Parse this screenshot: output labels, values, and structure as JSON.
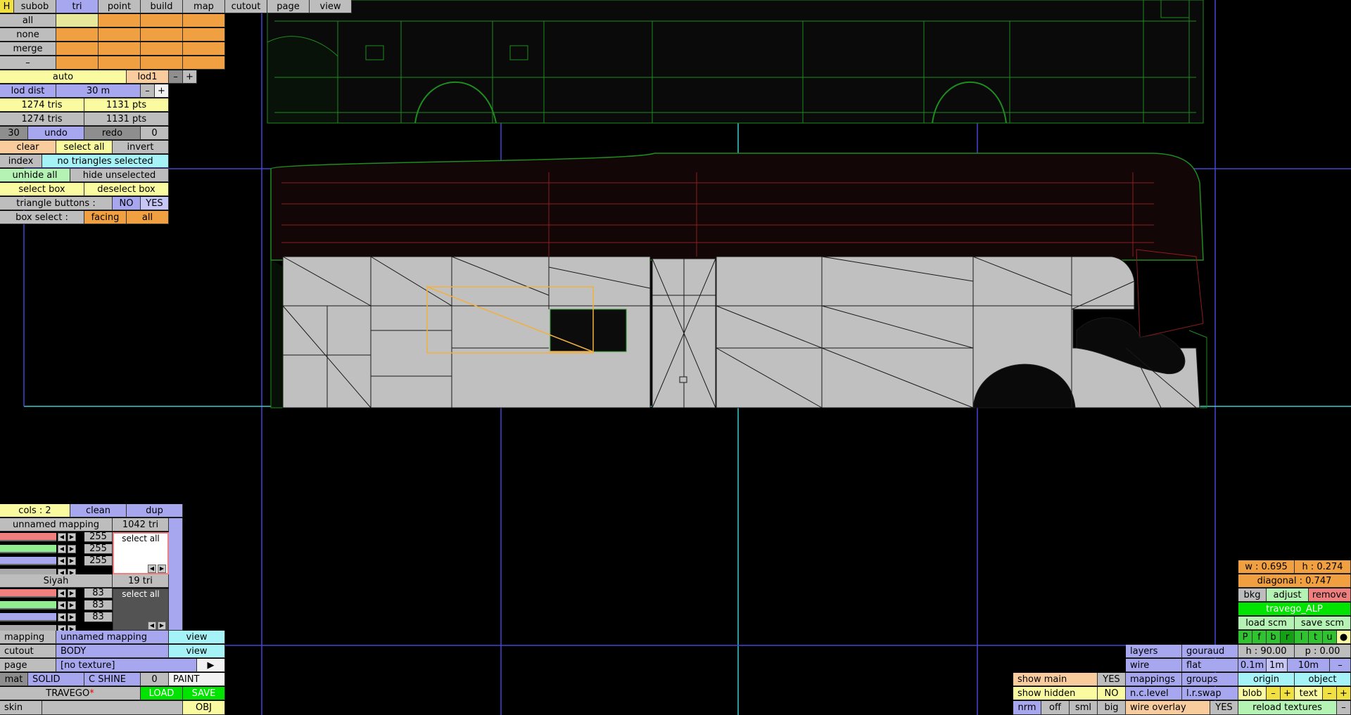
{
  "tabs": {
    "h": "H",
    "subob": "subob",
    "tri": "tri",
    "point": "point",
    "build": "build",
    "map": "map",
    "cutout": "cutout",
    "page": "page",
    "view": "view"
  },
  "subob_panel": {
    "all": "all",
    "none": "none",
    "merge": "merge",
    "dash": "–"
  },
  "lod": {
    "auto": "auto",
    "level": "lod1",
    "minus": "–",
    "plus": "+",
    "dist_label": "lod dist",
    "dist_value": "30 m"
  },
  "stats": {
    "tris1": "1274 tris",
    "pts1": "1131 pts",
    "tris2": "1274 tris",
    "pts2": "1131 pts"
  },
  "undo": {
    "count": "30",
    "undo": "undo",
    "redo": "redo",
    "redo_count": "0"
  },
  "selection": {
    "clear": "clear",
    "select_all": "select all",
    "invert": "invert",
    "index": "index",
    "status": "no triangles selected",
    "unhide_all": "unhide all",
    "hide_unselected": "hide unselected",
    "select_box": "select box",
    "deselect_box": "deselect box",
    "triangle_buttons": "triangle buttons :",
    "no": "NO",
    "yes": "YES",
    "box_select": "box select :",
    "facing": "facing",
    "all": "all"
  },
  "mapping_panel": {
    "cols": "cols : 2",
    "clean": "clean",
    "dup": "dup",
    "mapping_name": "unnamed mapping",
    "mapping_tris": "1042 tri",
    "rgb1": [
      "255",
      "255",
      "255"
    ],
    "select_all_1": "select all",
    "material_name": "Siyah",
    "material_tris": "19 tri",
    "rgb2": [
      "83",
      "83",
      "83"
    ],
    "select_all_2": "select all"
  },
  "bottom_left": {
    "mapping_label": "mapping",
    "mapping_value": "unnamed mapping",
    "view1": "view",
    "cutout_label": "cutout",
    "cutout_value": "BODY",
    "view2": "view",
    "page_label": "page",
    "page_value": "[no texture]",
    "play": "▶",
    "mat": "mat",
    "solid": "SOLID",
    "cshine": "C SHINE",
    "zero": "0",
    "paint": "PAINT",
    "model": "TRAVEGO",
    "modified_mark": "*",
    "load": "LOAD",
    "save": "SAVE",
    "skin": "skin",
    "obj": "OBJ"
  },
  "right_panel": {
    "w": "w : 0.695",
    "h": "h : 0.274",
    "diagonal": "diagonal : 0.747",
    "bkg": "bkg",
    "adjust": "adjust",
    "remove": "remove",
    "name": "travego_ALP",
    "load_scm": "load scm",
    "save_scm": "save scm",
    "letters": [
      "P",
      "f",
      "b",
      "r",
      "l",
      "t",
      "u"
    ],
    "dot": "●",
    "hdeg": "h : 90.00",
    "pdeg": "p : 0.00",
    "s01": "0.1m",
    "s1": "1m",
    "s10": "10m",
    "sdash": "–",
    "origin": "origin",
    "object": "object",
    "blob": "blob",
    "minus": "–",
    "plus": "+",
    "text": "text",
    "reload": "reload textures",
    "rminus": "–"
  },
  "view_panel": {
    "layers": "layers",
    "gouraud": "gouraud",
    "wire": "wire",
    "flat": "flat",
    "mappings": "mappings",
    "groups": "groups",
    "nclevel": "n.c.level",
    "lrswap": "l.r.swap",
    "show_main": "show main",
    "show_main_val": "YES",
    "show_hidden": "show hidden",
    "show_hidden_val": "NO",
    "nrm": "nrm",
    "off": "off",
    "sml": "sml",
    "big": "big",
    "wire_overlay": "wire overlay",
    "wire_overlay_val": "YES"
  },
  "colors": {
    "panel_orange": "#f0a040",
    "panel_yellow": "#fafaa0",
    "panel_blue": "#a7a7ef",
    "panel_cyan": "#a5f3f7",
    "grid_blue": "#4646d2",
    "grid_cyan": "#3cc8c8",
    "mesh_gray": "#c0c0c0",
    "wire_green": "#1e8c1e",
    "wire_red": "#8c1e1e",
    "selection_box": "#f0b040"
  }
}
